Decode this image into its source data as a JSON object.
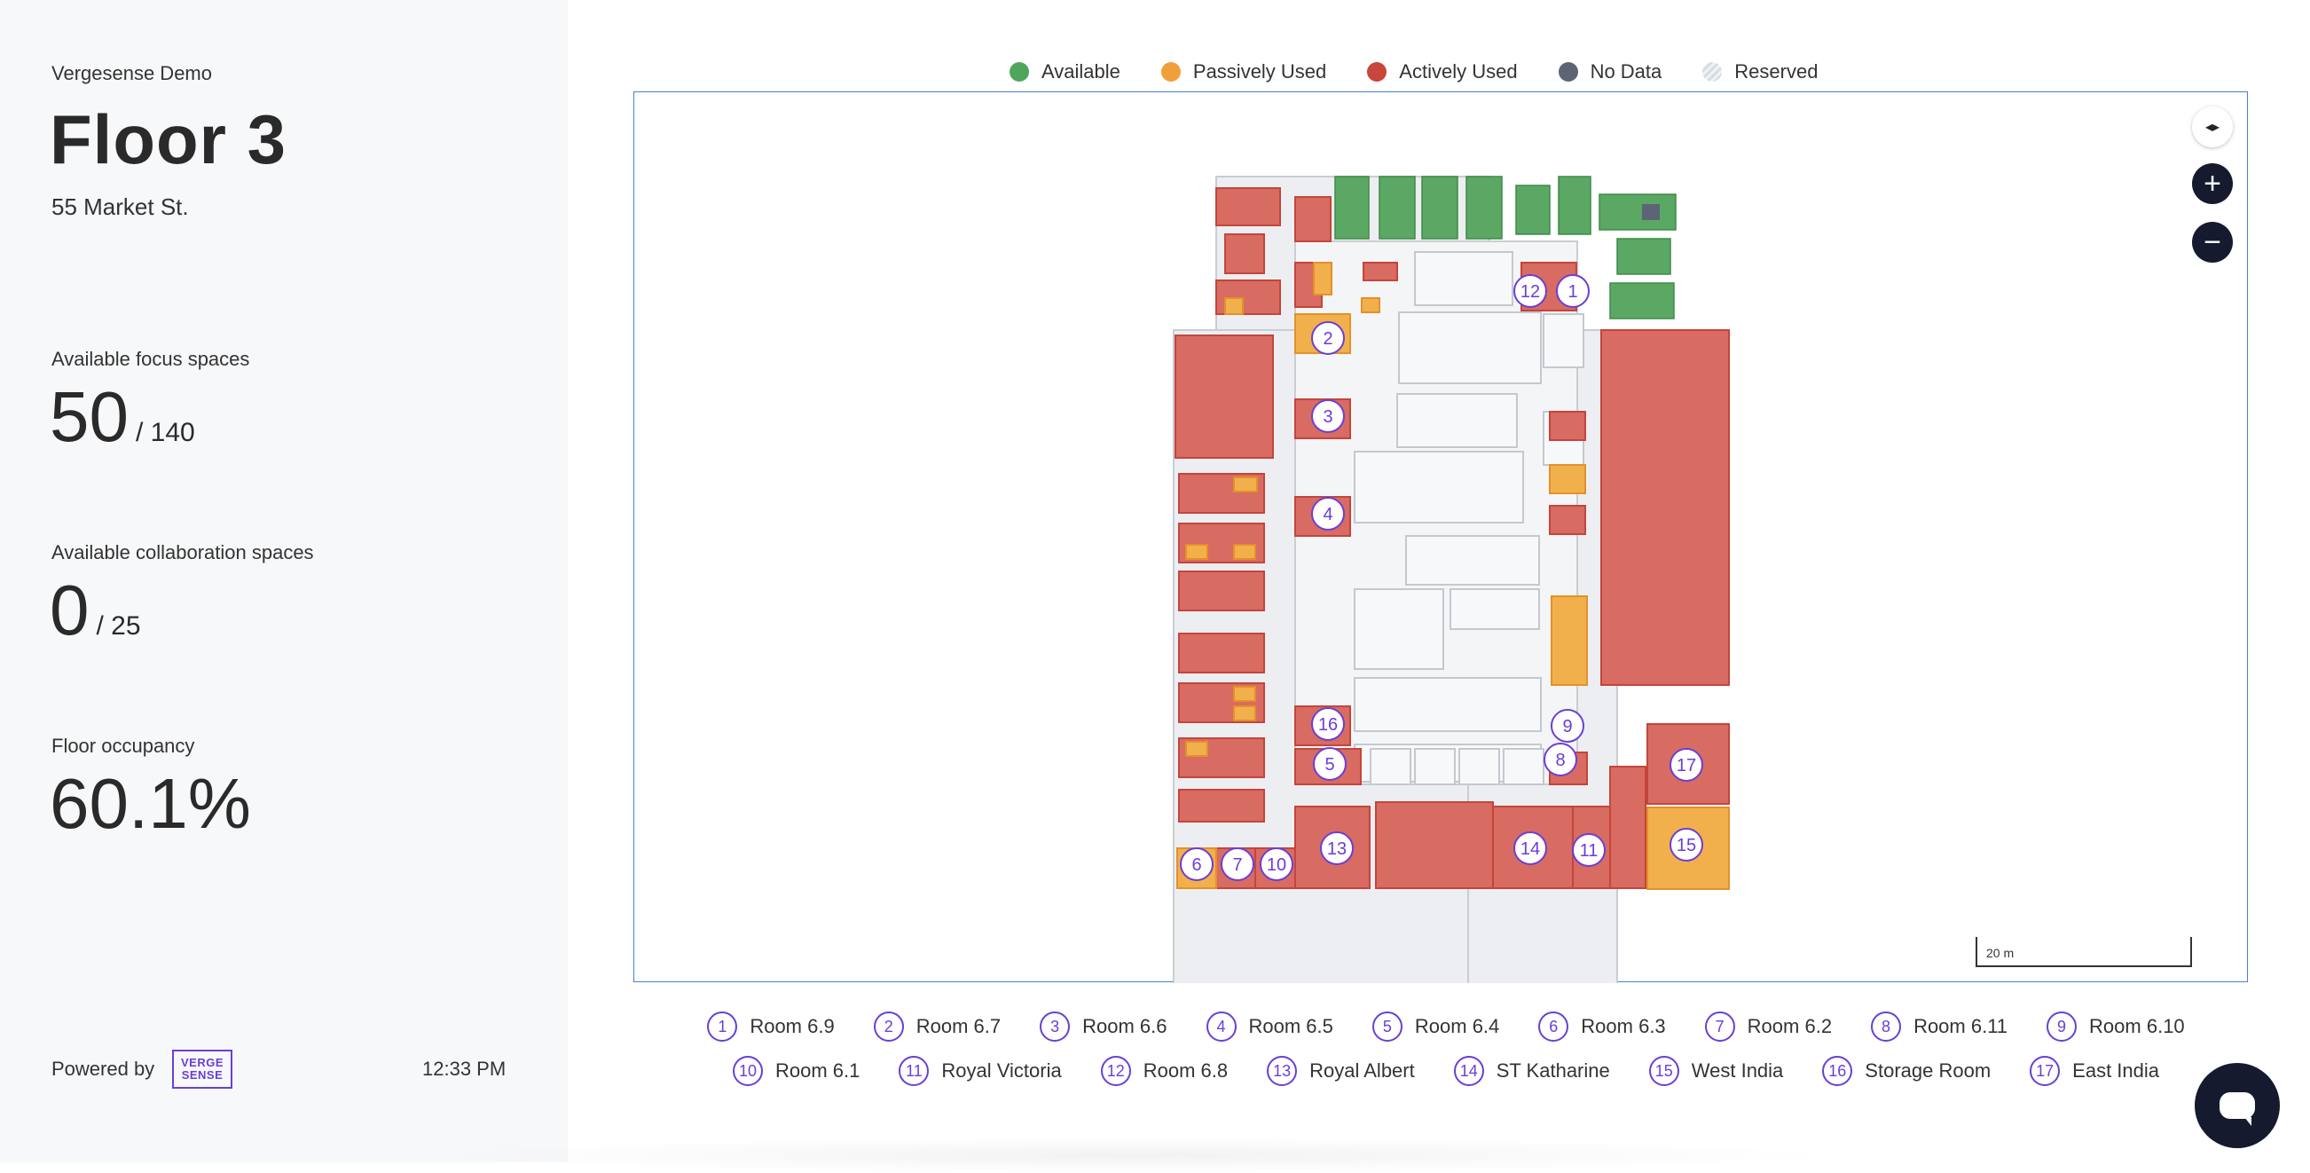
{
  "sidebar": {
    "org": "Vergesense Demo",
    "floor_title": "Floor 3",
    "address": "55 Market St.",
    "focus_label": "Available focus spaces",
    "focus_value": "50",
    "focus_total": "/ 140",
    "collab_label": "Available collaboration spaces",
    "collab_value": "0",
    "collab_total": "/ 25",
    "occupancy_label": "Floor occupancy",
    "occupancy_value": "60.1%",
    "powered_by": "Powered by",
    "logo_text": "VERGE SENSE",
    "time": "12:33 PM"
  },
  "legend": [
    {
      "label": "Available",
      "color": "#4fa65b"
    },
    {
      "label": "Passively Used",
      "color": "#f0a03a"
    },
    {
      "label": "Actively Used",
      "color": "#c8463c"
    },
    {
      "label": "No Data",
      "color": "#5d6475"
    },
    {
      "label": "Reserved",
      "color": "#d8dce2"
    }
  ],
  "map": {
    "compass_icon": "compass-icon",
    "zoom_in": "+",
    "zoom_out": "−",
    "scale_label": "20 m"
  },
  "rooms": [
    {
      "num": "1",
      "name": "Room 6.9"
    },
    {
      "num": "2",
      "name": "Room 6.7"
    },
    {
      "num": "3",
      "name": "Room 6.6"
    },
    {
      "num": "4",
      "name": "Room 6.5"
    },
    {
      "num": "5",
      "name": "Room 6.4"
    },
    {
      "num": "6",
      "name": "Room 6.3"
    },
    {
      "num": "7",
      "name": "Room 6.2"
    },
    {
      "num": "8",
      "name": "Room 6.11"
    },
    {
      "num": "9",
      "name": "Room 6.10"
    },
    {
      "num": "10",
      "name": "Room 6.1"
    },
    {
      "num": "11",
      "name": "Royal Victoria"
    },
    {
      "num": "12",
      "name": "Room 6.8"
    },
    {
      "num": "13",
      "name": "Royal Albert"
    },
    {
      "num": "14",
      "name": "ST Katharine"
    },
    {
      "num": "15",
      "name": "West India"
    },
    {
      "num": "16",
      "name": "Storage Room"
    },
    {
      "num": "17",
      "name": "East India"
    }
  ]
}
